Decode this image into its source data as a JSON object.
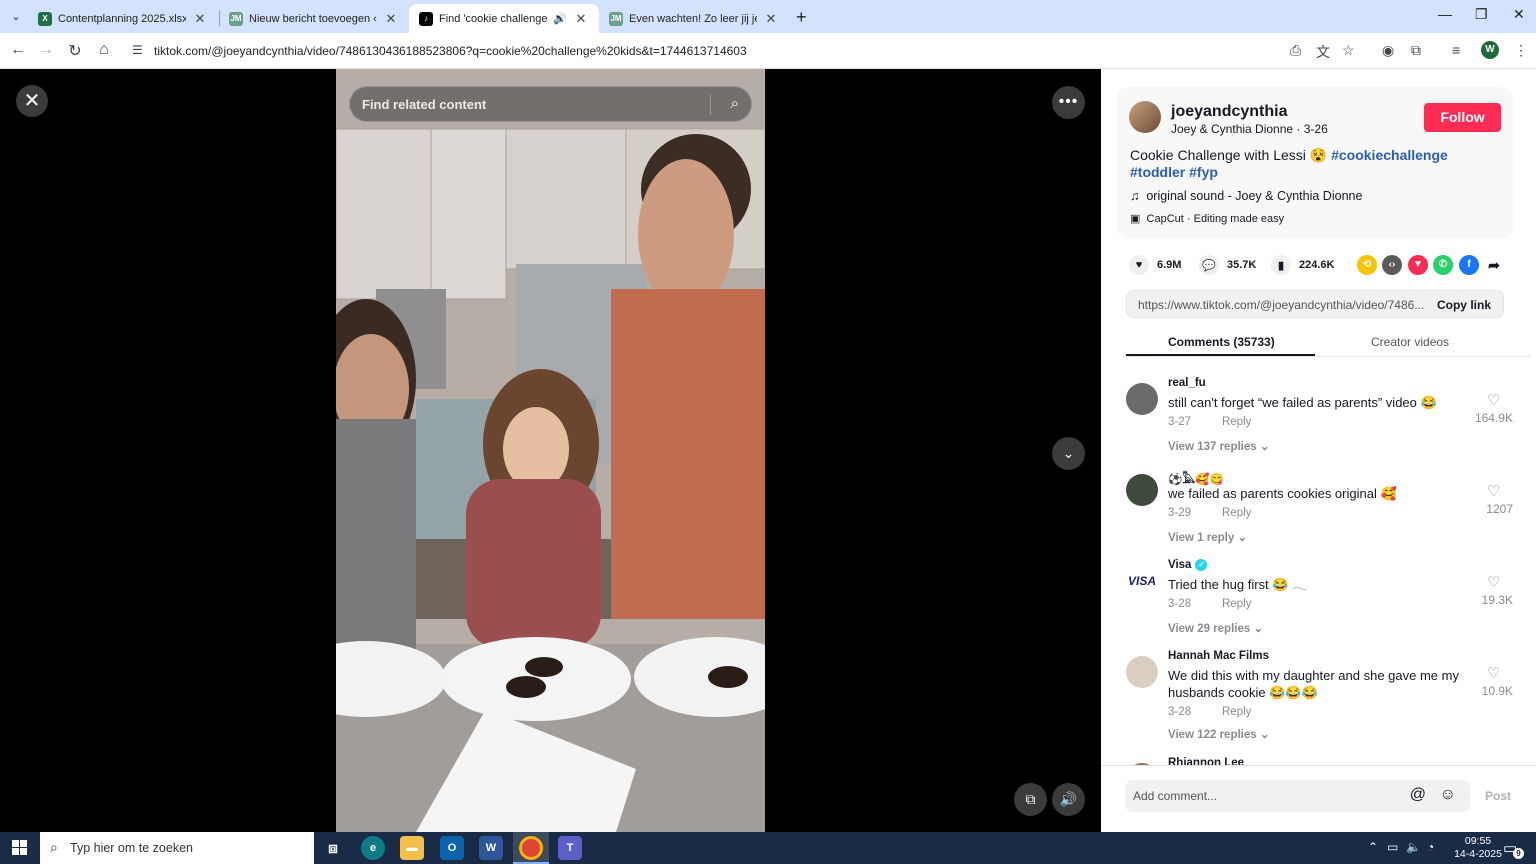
{
  "browser": {
    "tabs": [
      {
        "title": "Contentplanning 2025.xlsx",
        "icon": "excel-icon",
        "color": "#1e7145"
      },
      {
        "title": "Nieuw bericht toevoegen ‹ J/M",
        "icon": "jm-icon",
        "color": "#6aa28b"
      },
      {
        "title": "Find 'cookie challenge kids'",
        "icon": "tiktok-icon",
        "color": "#000000",
        "active": true
      },
      {
        "title": "Even wachten! Zo leer jij je kind",
        "icon": "jm-icon",
        "color": "#6aa28b"
      }
    ],
    "url": "tiktok.com/@joeyandcynthia/video/7486130436188523806?q=cookie%20challenge%20kids&t=1744613714603",
    "profile_initial": "W"
  },
  "video": {
    "search_placeholder": "Find related content"
  },
  "panel": {
    "username": "joeyandcynthia",
    "nickname": "Joey & Cynthia Dionne",
    "date": "3-26",
    "follow_label": "Follow",
    "description": "Cookie Challenge with Lessi 😵",
    "hashtags": [
      "#cookiechallenge",
      "#toddler",
      "#fyp"
    ],
    "sound": "original sound - Joey & Cynthia Dionne",
    "capcut": "CapCut · Editing made easy",
    "stats": {
      "likes": "6.9M",
      "comments": "35.7K",
      "saves": "224.6K"
    },
    "share_icons": [
      {
        "name": "repost-icon",
        "color": "#f6c400"
      },
      {
        "name": "embed-icon",
        "color": "#5b5b5b"
      },
      {
        "name": "send-icon",
        "color": "#fe2c55"
      },
      {
        "name": "whatsapp-icon",
        "color": "#25d366"
      },
      {
        "name": "facebook-icon",
        "color": "#1877f2"
      },
      {
        "name": "share-arrow-icon",
        "color": "#161823"
      }
    ],
    "copy_url": "https://www.tiktok.com/@joeyandcynthia/video/7486...",
    "copy_label": "Copy link",
    "tabs": {
      "comments": "Comments (35733)",
      "creator": "Creator videos"
    },
    "comments": [
      {
        "user": "real_fu",
        "text": "still can't forget “we failed as parents” video 😂",
        "date": "3-27",
        "reply": "Reply",
        "likes": "164.9K",
        "more": "View 137 replies ⌄",
        "avatar_color": "#6b6b6b"
      },
      {
        "user": "⚽️𓅓🥰😋",
        "text": "we failed as parents cookies original 🥰",
        "date": "3-29",
        "reply": "Reply",
        "likes": "1207",
        "more": "View 1 reply ⌄",
        "avatar_color": "#3f4a3c"
      },
      {
        "user": "Visa",
        "text": "Tried the hug first 😂 𓂃",
        "date": "3-28",
        "reply": "Reply",
        "likes": "19.3K",
        "more": "View 29 replies ⌄",
        "avatar_color": "#ffffff",
        "verified": true,
        "avatar_text": "VISA"
      },
      {
        "user": "Hannah Mac Films",
        "text": "We did this with my daughter and she gave me my husbands cookie 😂😂😂",
        "date": "3-28",
        "reply": "Reply",
        "likes": "10.9K",
        "more": "View 122 replies ⌄",
        "avatar_color": "#d8cfc1"
      },
      {
        "user": "Rhiannon Lee",
        "avatar_color": "#9b6f55"
      }
    ],
    "comment_placeholder": "Add comment...",
    "post_label": "Post"
  },
  "taskbar": {
    "search_placeholder": "Typ hier om te zoeken",
    "time": "09:55",
    "date": "14-4-2025",
    "notifications": "9"
  }
}
